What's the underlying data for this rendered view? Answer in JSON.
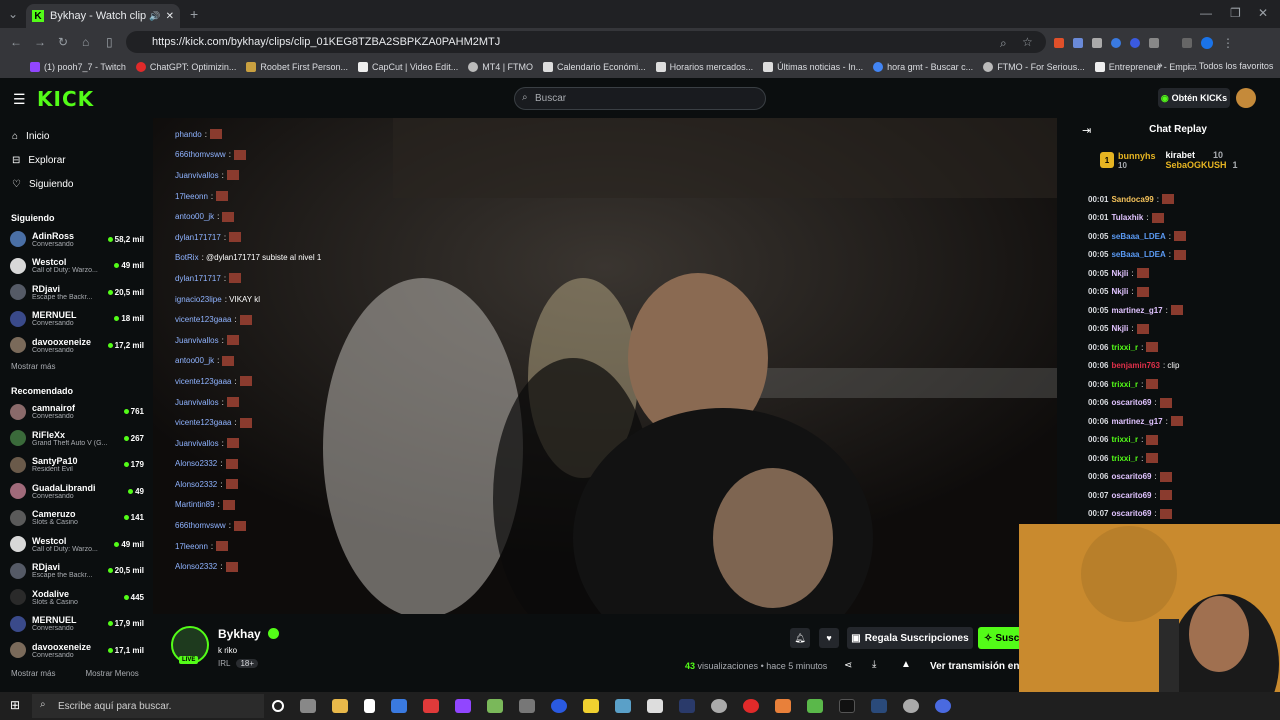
{
  "browser": {
    "tab_title": "Bykhay - Watch clips on Kic",
    "url": "https://kick.com/bykhay/clips/clip_01KEG8TZBA2SBPKZA0PAHM2MTJ",
    "bookmarks": [
      "(1) pooh7_7 - Twitch",
      "ChatGPT: Optimizin...",
      "Roobet First Person...",
      "CapCut | Video Edit...",
      "MT4 | FTMO",
      "Calendario Económi...",
      "Horarios mercados...",
      "Últimas noticias - In...",
      "hora gmt - Buscar c...",
      "FTMO - For Serious...",
      "Entrepreneur - Empi..."
    ],
    "all_bookmarks": "Todos los favoritos"
  },
  "header": {
    "logo": "KICK",
    "search_placeholder": "Buscar",
    "kicks_button": "Obtén KICKs"
  },
  "sidebar": {
    "nav": [
      {
        "label": "Inicio",
        "icon": "home-icon"
      },
      {
        "label": "Explorar",
        "icon": "compass-icon"
      },
      {
        "label": "Siguiendo",
        "icon": "heart-icon"
      }
    ],
    "following_title": "Siguiendo",
    "following": [
      {
        "name": "AdinRoss",
        "category": "Conversando",
        "viewers": "58,2 mil",
        "color": "#4a6fa5"
      },
      {
        "name": "Westcol",
        "category": "Call of Duty: Warzo...",
        "viewers": "49 mil",
        "color": "#d8d8d8"
      },
      {
        "name": "RDjavi",
        "category": "Escape the Backr...",
        "viewers": "20,5 mil",
        "color": "#555a66"
      },
      {
        "name": "MERNUEL",
        "category": "Conversando",
        "viewers": "18 mil",
        "color": "#3a4a8a"
      },
      {
        "name": "davooxeneize",
        "category": "Conversando",
        "viewers": "17,2 mil",
        "color": "#7a6a5a"
      }
    ],
    "show_more": "Mostrar más",
    "recommended_title": "Recomendado",
    "recommended": [
      {
        "name": "camnairof",
        "category": "Conversando",
        "viewers": "761",
        "color": "#8a6a6a"
      },
      {
        "name": "RiFleXx",
        "category": "Grand Theft Auto V (G...",
        "viewers": "267",
        "color": "#3a6a3a"
      },
      {
        "name": "SantyPa10",
        "category": "Resident Evil",
        "viewers": "179",
        "color": "#6a5a4a"
      },
      {
        "name": "GuadaLibrandi",
        "category": "Conversando",
        "viewers": "49",
        "color": "#a06a7a"
      },
      {
        "name": "Cameruzo",
        "category": "Slots & Casino",
        "viewers": "141",
        "color": "#5a5a5a"
      },
      {
        "name": "Westcol",
        "category": "Call of Duty: Warzo...",
        "viewers": "49 mil",
        "color": "#d8d8d8"
      },
      {
        "name": "RDjavi",
        "category": "Escape the Backr...",
        "viewers": "20,5 mil",
        "color": "#555a66"
      },
      {
        "name": "Xodalive",
        "category": "Slots & Casino",
        "viewers": "445",
        "color": "#2a2a2a"
      },
      {
        "name": "MERNUEL",
        "category": "Conversando",
        "viewers": "17,9 mil",
        "color": "#3a4a8a"
      },
      {
        "name": "davooxeneize",
        "category": "Conversando",
        "viewers": "17,1 mil",
        "color": "#7a6a5a"
      }
    ],
    "show_more2": "Mostrar más",
    "show_less": "Mostrar Menos"
  },
  "video_overlay": {
    "lines": [
      {
        "user": "phando",
        "text": ":"
      },
      {
        "user": "666thomvsww",
        "text": ":"
      },
      {
        "user": "Juanvivallos",
        "text": ":"
      },
      {
        "user": "17leeonn",
        "text": ":"
      },
      {
        "user": "antoo00_jk",
        "text": ":"
      },
      {
        "user": "dylan171717",
        "text": ":"
      },
      {
        "user": "BotRix",
        "text": ": @dylan171717 subiste al nivel 1"
      },
      {
        "user": "dylan171717",
        "text": ":"
      },
      {
        "user": "ignacio23lipe",
        "text": ": VIKAY kl"
      },
      {
        "user": "vicente123gaaa",
        "text": ":"
      },
      {
        "user": "Juanvivallos",
        "text": ":"
      },
      {
        "user": "antoo00_jk",
        "text": ":"
      },
      {
        "user": "vicente123gaaa",
        "text": ":"
      },
      {
        "user": "Juanvivallos",
        "text": ":"
      },
      {
        "user": "vicente123gaaa",
        "text": ":"
      },
      {
        "user": "Juanvivallos",
        "text": ":"
      },
      {
        "user": "Alonso2332",
        "text": ":"
      },
      {
        "user": "Alonso2332",
        "text": ":"
      },
      {
        "user": "Martintin89",
        "text": ":"
      },
      {
        "user": "666thomvsww",
        "text": ":"
      },
      {
        "user": "17leeonn",
        "text": ":"
      },
      {
        "user": "Alonso2332",
        "text": ":"
      }
    ]
  },
  "channel": {
    "name": "Bykhay",
    "live_label": "LIVE",
    "clip_title": "k riko",
    "category": "IRL",
    "age_tag": "18+",
    "gift_button": "Regala Suscripciones",
    "subscribe_button": "Susc",
    "views_count": "43",
    "views_label": "visualizaciones",
    "time_ago": "hace 5 minutos",
    "watch_button": "Ver transmisión en"
  },
  "chat": {
    "title": "Chat Replay",
    "podium": [
      {
        "name": "bunnyhs",
        "amount": "10",
        "rank": "1"
      },
      {
        "name": "kirabet",
        "amount": "10"
      },
      {
        "name": "SebaOGKUSH",
        "amount": "1"
      }
    ],
    "messages": [
      {
        "time": "00:01",
        "user": "Sandoca99",
        "text": ":",
        "color": "#f5c35b"
      },
      {
        "time": "00:01",
        "user": "Tulaxhik",
        "text": ":",
        "color": "#e0c3ff"
      },
      {
        "time": "00:05",
        "user": "seBaaa_LDEA",
        "text": ":",
        "color": "#5b9bf5"
      },
      {
        "time": "00:05",
        "user": "seBaaa_LDEA",
        "text": ":",
        "color": "#5b9bf5"
      },
      {
        "time": "00:05",
        "user": "Nkjli",
        "text": ":",
        "color": "#e0c3ff"
      },
      {
        "time": "00:05",
        "user": "Nkjli",
        "text": ":",
        "color": "#e0c3ff"
      },
      {
        "time": "00:05",
        "user": "martinez_g17",
        "text": ":",
        "color": "#e0c3ff"
      },
      {
        "time": "00:05",
        "user": "Nkjli",
        "text": ":",
        "color": "#e0c3ff"
      },
      {
        "time": "00:06",
        "user": "trixxi_r",
        "text": ":",
        "color": "#53fc18"
      },
      {
        "time": "00:06",
        "user": "benjamin763",
        "text": ": clip",
        "color": "#e0304a"
      },
      {
        "time": "00:06",
        "user": "trixxi_r",
        "text": ":",
        "color": "#53fc18"
      },
      {
        "time": "00:06",
        "user": "oscarito69",
        "text": ":",
        "color": "#e0c3ff"
      },
      {
        "time": "00:06",
        "user": "martinez_g17",
        "text": ":",
        "color": "#e0c3ff"
      },
      {
        "time": "00:06",
        "user": "trixxi_r",
        "text": ":",
        "color": "#53fc18"
      },
      {
        "time": "00:06",
        "user": "trixxi_r",
        "text": ":",
        "color": "#53fc18"
      },
      {
        "time": "00:06",
        "user": "oscarito69",
        "text": ":",
        "color": "#e0c3ff"
      },
      {
        "time": "00:07",
        "user": "oscarito69",
        "text": ":",
        "color": "#e0c3ff"
      },
      {
        "time": "00:07",
        "user": "oscarito69",
        "text": ":",
        "color": "#e0c3ff"
      }
    ]
  },
  "taskbar": {
    "search_placeholder": "Escribe aquí para buscar."
  },
  "colors": {
    "accent": "#53fc18",
    "background": "#0b0e0f"
  }
}
